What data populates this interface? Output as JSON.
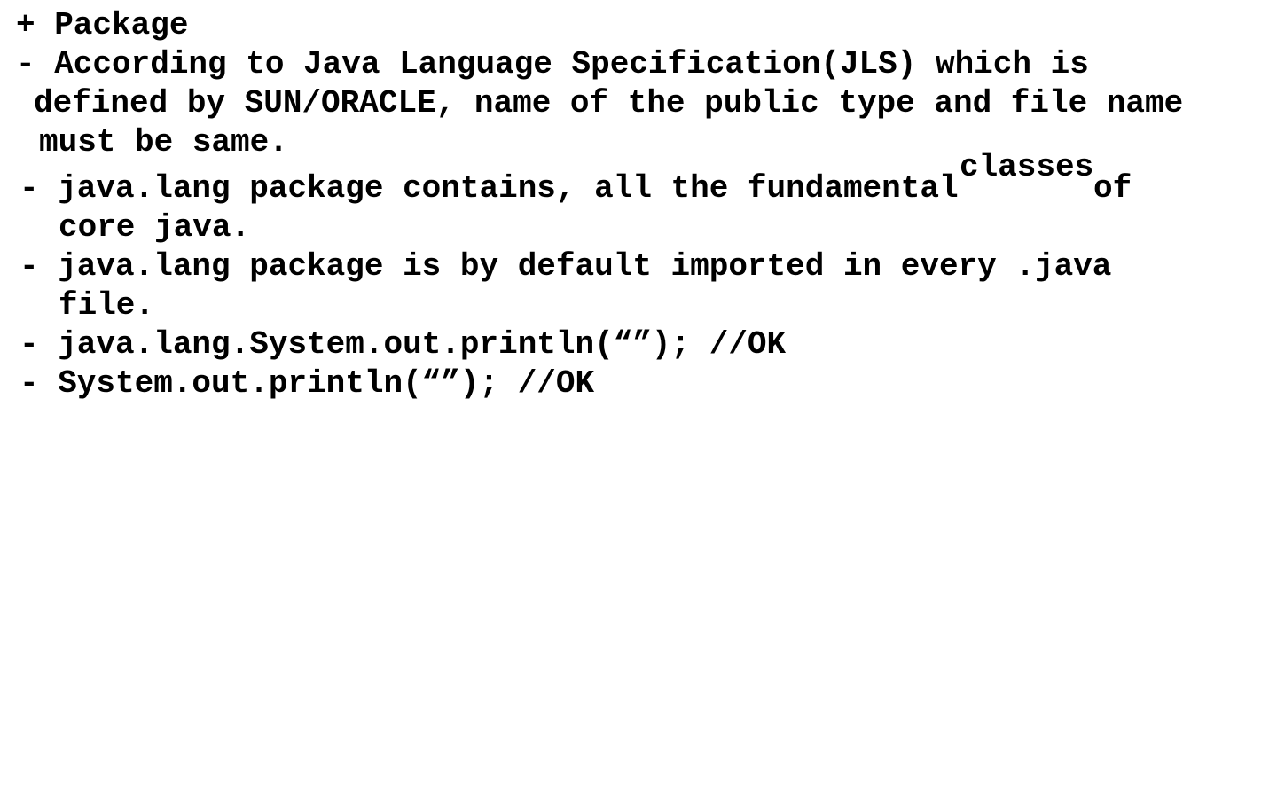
{
  "heading": "+ Package",
  "bullet_jls": {
    "line1": "- According to Java Language Specification(JLS) which is",
    "line2": "defined by SUN/ORACLE, name of the public type and file name",
    "line3": "must be same."
  },
  "bullet_java_lang_contains": {
    "line1_text": "- java.lang package contains, all the fundamental",
    "inserted_word": "classes",
    "line1_tail": "of",
    "line2": "core java."
  },
  "bullet_default_import": {
    "line1": "- java.lang package is by default imported in every .java",
    "line2": "file."
  },
  "code_full": "- java.lang.System.out.println(“”); //OK",
  "code_short": "- System.out.println(“”); //OK"
}
